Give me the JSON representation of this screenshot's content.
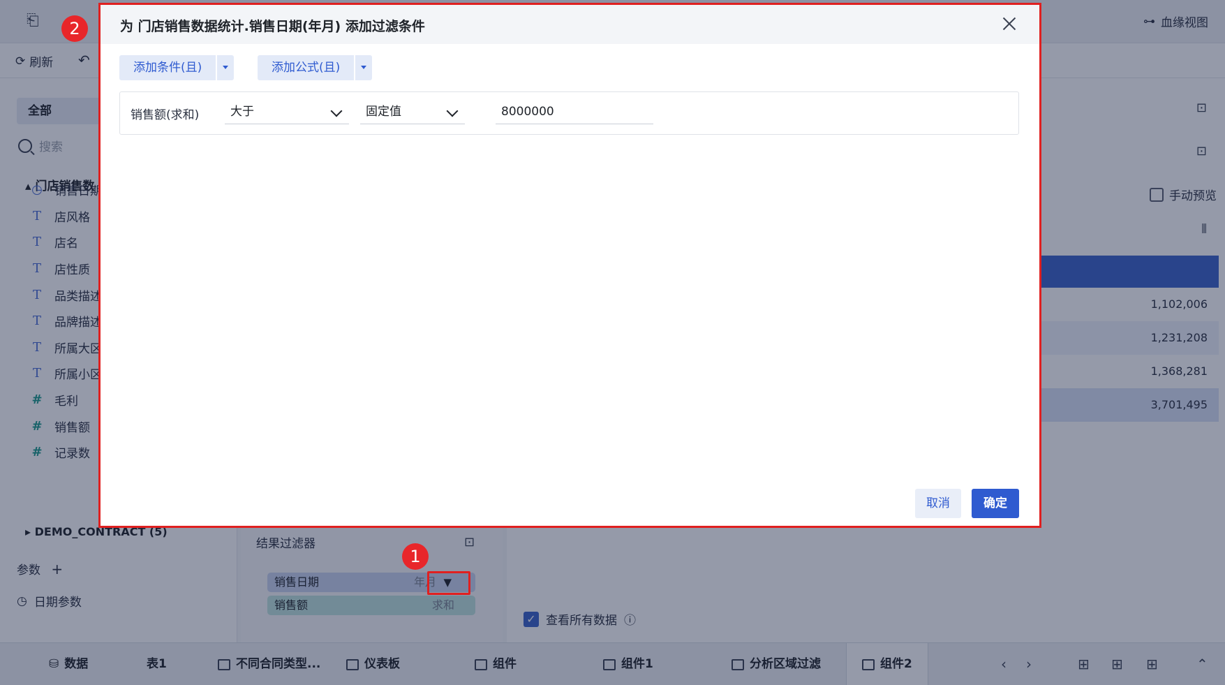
{
  "app": {
    "lineage_view": "血缘视图",
    "refresh": "刷新",
    "tab_all": "全部",
    "search_placeholder": "搜索",
    "tree_head": "门店销售数",
    "fields": [
      {
        "icon": "clock-icon",
        "label": "销售日期"
      },
      {
        "icon": "text-type-icon",
        "label": "店风格"
      },
      {
        "icon": "text-type-icon",
        "label": "店名"
      },
      {
        "icon": "text-type-icon",
        "label": "店性质"
      },
      {
        "icon": "text-type-icon",
        "label": "品类描述"
      },
      {
        "icon": "text-type-icon",
        "label": "品牌描述"
      },
      {
        "icon": "text-type-icon",
        "label": "所属大区"
      },
      {
        "icon": "text-type-icon",
        "label": "所属小区"
      },
      {
        "icon": "number-type-icon",
        "label": "毛利"
      },
      {
        "icon": "number-type-icon",
        "label": "销售额"
      },
      {
        "icon": "number-type-icon",
        "label": "记录数"
      }
    ],
    "demo_contract": "DEMO_CONTRACT (5)",
    "params_label": "参数",
    "date_param": "日期参数",
    "result_filter": "结果过滤器",
    "filter_pills": [
      {
        "label": "销售日期",
        "sub": "年月"
      },
      {
        "label": "销售额",
        "sub": "求和"
      }
    ],
    "manual_preview": "手动预览",
    "table_values": [
      "1,102,006",
      "1,231,208",
      "1,368,281",
      "3,701,495"
    ],
    "view_all_data": "查看所有数据",
    "bottom_tabs": [
      "数据",
      "表1",
      "不同合同类型...",
      "仪表板",
      "组件",
      "组件1",
      "分析区域过滤",
      "组件2"
    ],
    "badges": [
      "1",
      "2"
    ]
  },
  "modal": {
    "title": "为 门店销售数据统计.销售日期(年月) 添加过滤条件",
    "add_condition": "添加条件(且)",
    "add_formula": "添加公式(且)",
    "condition": {
      "field": "销售额(求和)",
      "operator": "大于",
      "value_type": "固定值",
      "value": "8000000"
    },
    "cancel": "取消",
    "confirm": "确定"
  },
  "colors": {
    "accent": "#2f5bd0",
    "highlight": "#e02020"
  }
}
